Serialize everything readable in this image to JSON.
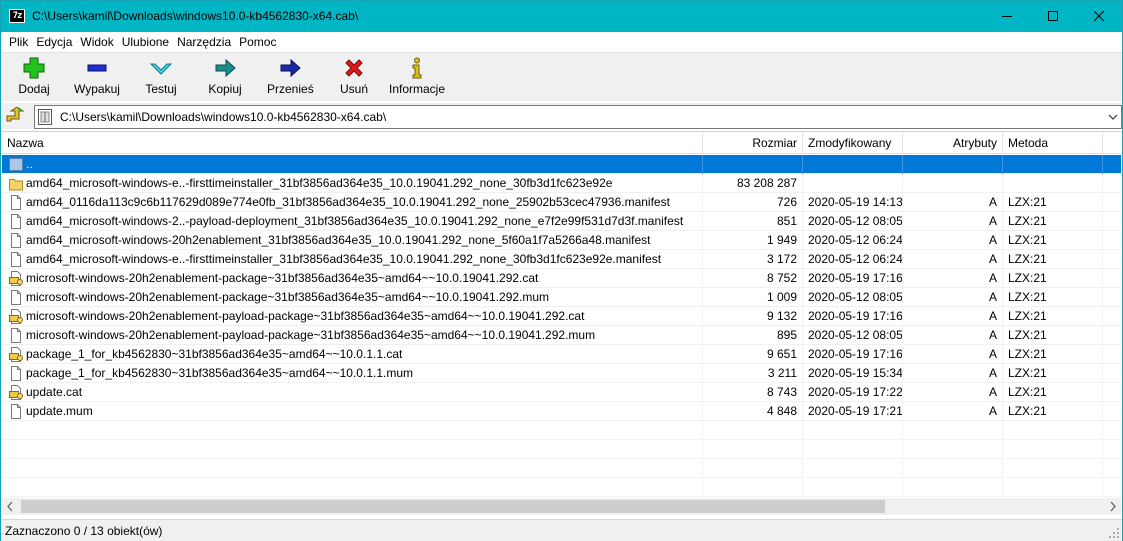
{
  "window": {
    "title": "C:\\Users\\kamil\\Downloads\\windows10.0-kb4562830-x64.cab\\",
    "app_icon_text": "7z",
    "accent_color": "#00b6c4"
  },
  "menu": [
    "Plik",
    "Edycja",
    "Widok",
    "Ulubione",
    "Narzędzia",
    "Pomoc"
  ],
  "toolbar": {
    "add": "Dodaj",
    "extract": "Wypakuj",
    "test": "Testuj",
    "copy": "Kopiuj",
    "move": "Przenieś",
    "delete": "Usuń",
    "info": "Informacje"
  },
  "address": {
    "path": "C:\\Users\\kamil\\Downloads\\windows10.0-kb4562830-x64.cab\\"
  },
  "columns": {
    "name": "Nazwa",
    "size": "Rozmiar",
    "modified": "Zmodyfikowany",
    "attributes": "Atrybuty",
    "method": "Metoda"
  },
  "rows": [
    {
      "icon": "folder-up-icon",
      "name": "..",
      "size": "",
      "modified": "",
      "attr": "",
      "method": "",
      "selected": true
    },
    {
      "icon": "folder-icon",
      "name": "amd64_microsoft-windows-e..-firsttimeinstaller_31bf3856ad364e35_10.0.19041.292_none_30fb3d1fc623e92e",
      "size": "83 208 287",
      "modified": "",
      "attr": "",
      "method": ""
    },
    {
      "icon": "file-icon",
      "name": "amd64_0116da113c9c6b117629d089e774e0fb_31bf3856ad364e35_10.0.19041.292_none_25902b53cec47936.manifest",
      "size": "726",
      "modified": "2020-05-19 14:13",
      "attr": "A",
      "method": "LZX:21"
    },
    {
      "icon": "file-icon",
      "name": "amd64_microsoft-windows-2..-payload-deployment_31bf3856ad364e35_10.0.19041.292_none_e7f2e99f531d7d3f.manifest",
      "size": "851",
      "modified": "2020-05-12 08:05",
      "attr": "A",
      "method": "LZX:21"
    },
    {
      "icon": "file-icon",
      "name": "amd64_microsoft-windows-20h2enablement_31bf3856ad364e35_10.0.19041.292_none_5f60a1f7a5266a48.manifest",
      "size": "1 949",
      "modified": "2020-05-12 06:24",
      "attr": "A",
      "method": "LZX:21"
    },
    {
      "icon": "file-icon",
      "name": "amd64_microsoft-windows-e..-firsttimeinstaller_31bf3856ad364e35_10.0.19041.292_none_30fb3d1fc623e92e.manifest",
      "size": "3 172",
      "modified": "2020-05-12 06:24",
      "attr": "A",
      "method": "LZX:21"
    },
    {
      "icon": "cat-icon",
      "name": "microsoft-windows-20h2enablement-package~31bf3856ad364e35~amd64~~10.0.19041.292.cat",
      "size": "8 752",
      "modified": "2020-05-19 17:16",
      "attr": "A",
      "method": "LZX:21"
    },
    {
      "icon": "file-icon",
      "name": "microsoft-windows-20h2enablement-package~31bf3856ad364e35~amd64~~10.0.19041.292.mum",
      "size": "1 009",
      "modified": "2020-05-12 08:05",
      "attr": "A",
      "method": "LZX:21"
    },
    {
      "icon": "cat-icon",
      "name": "microsoft-windows-20h2enablement-payload-package~31bf3856ad364e35~amd64~~10.0.19041.292.cat",
      "size": "9 132",
      "modified": "2020-05-19 17:16",
      "attr": "A",
      "method": "LZX:21"
    },
    {
      "icon": "file-icon",
      "name": "microsoft-windows-20h2enablement-payload-package~31bf3856ad364e35~amd64~~10.0.19041.292.mum",
      "size": "895",
      "modified": "2020-05-12 08:05",
      "attr": "A",
      "method": "LZX:21"
    },
    {
      "icon": "cat-icon",
      "name": "package_1_for_kb4562830~31bf3856ad364e35~amd64~~10.0.1.1.cat",
      "size": "9 651",
      "modified": "2020-05-19 17:16",
      "attr": "A",
      "method": "LZX:21"
    },
    {
      "icon": "file-icon",
      "name": "package_1_for_kb4562830~31bf3856ad364e35~amd64~~10.0.1.1.mum",
      "size": "3 211",
      "modified": "2020-05-19 15:34",
      "attr": "A",
      "method": "LZX:21"
    },
    {
      "icon": "cat-icon",
      "name": "update.cat",
      "size": "8 743",
      "modified": "2020-05-19 17:22",
      "attr": "A",
      "method": "LZX:21"
    },
    {
      "icon": "file-icon",
      "name": "update.mum",
      "size": "4 848",
      "modified": "2020-05-19 17:21",
      "attr": "A",
      "method": "LZX:21"
    }
  ],
  "status": {
    "text": "Zaznaczono 0 / 13 obiekt(ów)"
  }
}
